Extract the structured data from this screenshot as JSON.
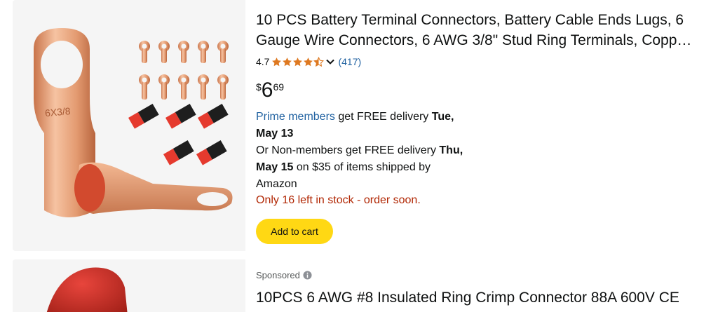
{
  "results": [
    {
      "title_line1": "10 PCS Battery Terminal Connectors, Battery Cable Ends Lugs, 6",
      "title_line2": "Gauge Wire Connectors, 6 AWG 3/8\" Stud Ring Terminals, Copp…",
      "rating": "4.7",
      "stars": 4.5,
      "review_count": "(417)",
      "price_symbol": "$",
      "price_whole": "6",
      "price_fraction": "69",
      "delivery_prime": "Prime members",
      "delivery_prime_text": " get FREE delivery ",
      "delivery_prime_date1": "Tue,",
      "delivery_prime_date2": "May 13",
      "delivery_nonmember_text": "Or Non-members get FREE delivery ",
      "delivery_nonmember_date1": "Thu,",
      "delivery_nonmember_date2": "May 15",
      "delivery_threshold": " on $35 of items shipped by",
      "delivery_shipper": "Amazon",
      "stock": "Only 16 left in stock - order soon.",
      "cart_label": "Add to cart",
      "image_icon": "copper-ring-terminal-image"
    },
    {
      "sponsored_label": "Sponsored",
      "title_line1": "10PCS 6 AWG #8 Insulated Ring Crimp Connector 88A 600V CE",
      "image_icon": "red-insulated-connector-image"
    }
  ],
  "colors": {
    "link": "#2162a1",
    "star": "#de7921",
    "stock": "#b12704",
    "cart_button": "#ffd814",
    "thumb_bg": "#f5f5f5"
  }
}
